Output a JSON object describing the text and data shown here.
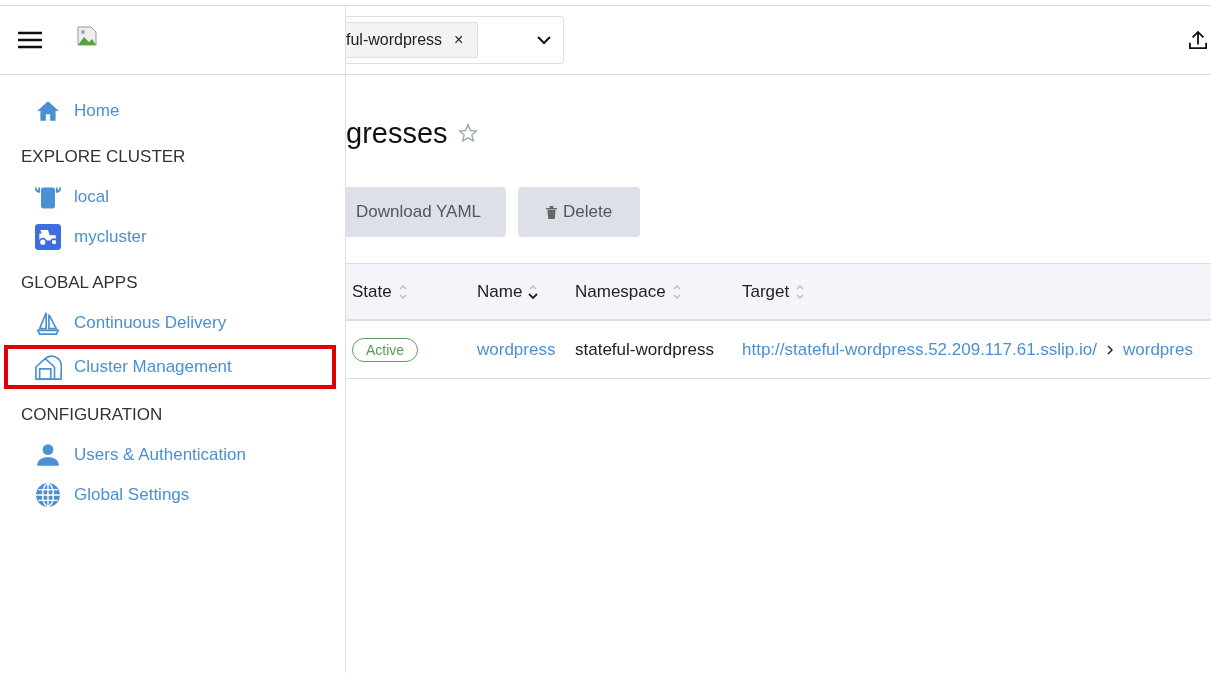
{
  "sidebar": {
    "items": [
      {
        "label": "Home",
        "kind": "home",
        "highlighted": false
      }
    ],
    "sections": [
      {
        "heading": "EXPLORE CLUSTER",
        "items": [
          {
            "label": "local",
            "kind": "bull",
            "highlighted": false
          },
          {
            "label": "mycluster",
            "kind": "tractor",
            "highlighted": false
          }
        ]
      },
      {
        "heading": "GLOBAL APPS",
        "items": [
          {
            "label": "Continuous Delivery",
            "kind": "sail",
            "highlighted": false
          },
          {
            "label": "Cluster Management",
            "kind": "barn",
            "highlighted": true
          }
        ]
      },
      {
        "heading": "CONFIGURATION",
        "items": [
          {
            "label": "Users & Authentication",
            "kind": "user",
            "highlighted": false
          },
          {
            "label": "Global Settings",
            "kind": "globe",
            "highlighted": false
          }
        ]
      }
    ]
  },
  "header": {
    "namespace_chip": "ful-wordpress",
    "chip_remove": "×"
  },
  "page": {
    "title": "gresses",
    "favorite": false
  },
  "buttons": [
    {
      "label": "Download YAML"
    },
    {
      "label": "Delete",
      "kind": "delete"
    }
  ],
  "table": {
    "columns": [
      {
        "label": "State",
        "sorted": false
      },
      {
        "label": "Name",
        "sorted": true
      },
      {
        "label": "Namespace",
        "sorted": false
      },
      {
        "label": "Target",
        "sorted": false
      }
    ],
    "rows": [
      {
        "state": "Active",
        "name": "wordpress",
        "namespace": "stateful-wordpress",
        "target": "http://stateful-wordpress.52.209.117.61.sslip.io/",
        "target_service": "wordpres"
      }
    ]
  }
}
